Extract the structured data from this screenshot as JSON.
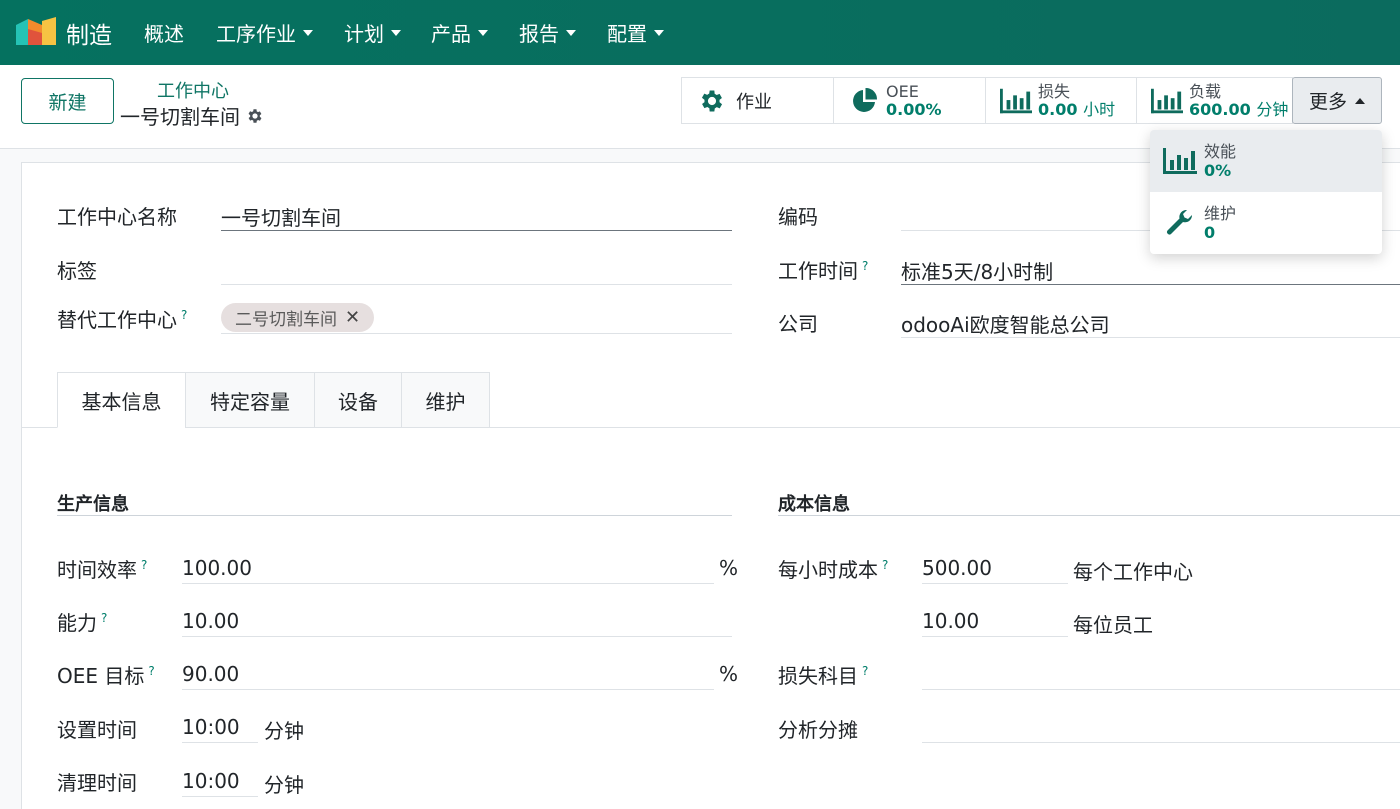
{
  "app": {
    "brand": "制造"
  },
  "nav": {
    "menus": [
      {
        "label": "概述",
        "dropdown": false
      },
      {
        "label": "工序作业",
        "dropdown": true
      },
      {
        "label": "计划",
        "dropdown": true
      },
      {
        "label": "产品",
        "dropdown": true
      },
      {
        "label": "报告",
        "dropdown": true
      },
      {
        "label": "配置",
        "dropdown": true
      }
    ]
  },
  "control": {
    "new_label": "新建",
    "breadcrumb_parent": "工作中心",
    "breadcrumb_current": "一号切割车间",
    "more_label": "更多"
  },
  "smart_buttons": {
    "ops": {
      "label": "作业"
    },
    "oee": {
      "label": "OEE",
      "value": "0.00%"
    },
    "loss": {
      "label": "损失",
      "value": "0.00",
      "unit": "小时"
    },
    "load": {
      "label": "负载",
      "value": "600.00",
      "unit": "分钟"
    }
  },
  "dropdown": {
    "efficiency": {
      "label": "效能",
      "value": "0%"
    },
    "maintenance": {
      "label": "维护",
      "value": "0"
    }
  },
  "form": {
    "name_label": "工作中心名称",
    "name_value": "一号切割车间",
    "tags_label": "标签",
    "alt_label": "替代工作中心",
    "alt_tag": "二号切割车间",
    "code_label": "编码",
    "hours_label": "工作时间",
    "hours_value": "标准5天/8小时制",
    "company_label": "公司",
    "company_value": "odooAi欧度智能总公司",
    "help_mark": "?"
  },
  "tabs": [
    "基本信息",
    "特定容量",
    "设备",
    "维护"
  ],
  "production": {
    "title": "生产信息",
    "time_eff_label": "时间效率",
    "time_eff_value": "100.00",
    "percent": "%",
    "capacity_label": "能力",
    "capacity_value": "10.00",
    "oee_target_label": "OEE 目标",
    "oee_target_value": "90.00",
    "setup_label": "设置时间",
    "setup_value": "10:00",
    "cleanup_label": "清理时间",
    "cleanup_value": "10:00",
    "minutes_unit": "分钟"
  },
  "cost": {
    "title": "成本信息",
    "cost_hour_label": "每小时成本",
    "cost_hour_value": "500.00",
    "per_wc": "每个工作中心",
    "employee_value": "10.00",
    "per_employee": "每位员工",
    "loss_account_label": "损失科目",
    "analytic_label": "分析分摊"
  },
  "colors": {
    "brand": "#05715f",
    "accent": "#017e6b"
  }
}
